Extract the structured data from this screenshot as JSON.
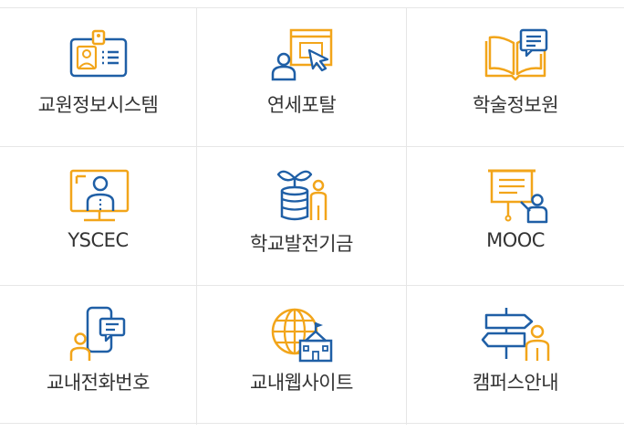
{
  "colors": {
    "blue": "#1f5fa6",
    "orange": "#f2a51a",
    "text": "#333333",
    "border": "#e6e6e6"
  },
  "tiles": [
    {
      "label": "교원정보시스템",
      "icon": "id-badge-icon"
    },
    {
      "label": "연세포탈",
      "icon": "portal-click-icon"
    },
    {
      "label": "학술정보원",
      "icon": "book-library-icon"
    },
    {
      "label": "YSCEC",
      "icon": "monitor-lecture-icon"
    },
    {
      "label": "학교발전기금",
      "icon": "fund-plant-icon"
    },
    {
      "label": "MOOC",
      "icon": "presentation-board-icon"
    },
    {
      "label": "교내전화번호",
      "icon": "phone-directory-icon"
    },
    {
      "label": "교내웹사이트",
      "icon": "campus-globe-icon"
    },
    {
      "label": "캠퍼스안내",
      "icon": "campus-guide-signpost-icon"
    }
  ]
}
